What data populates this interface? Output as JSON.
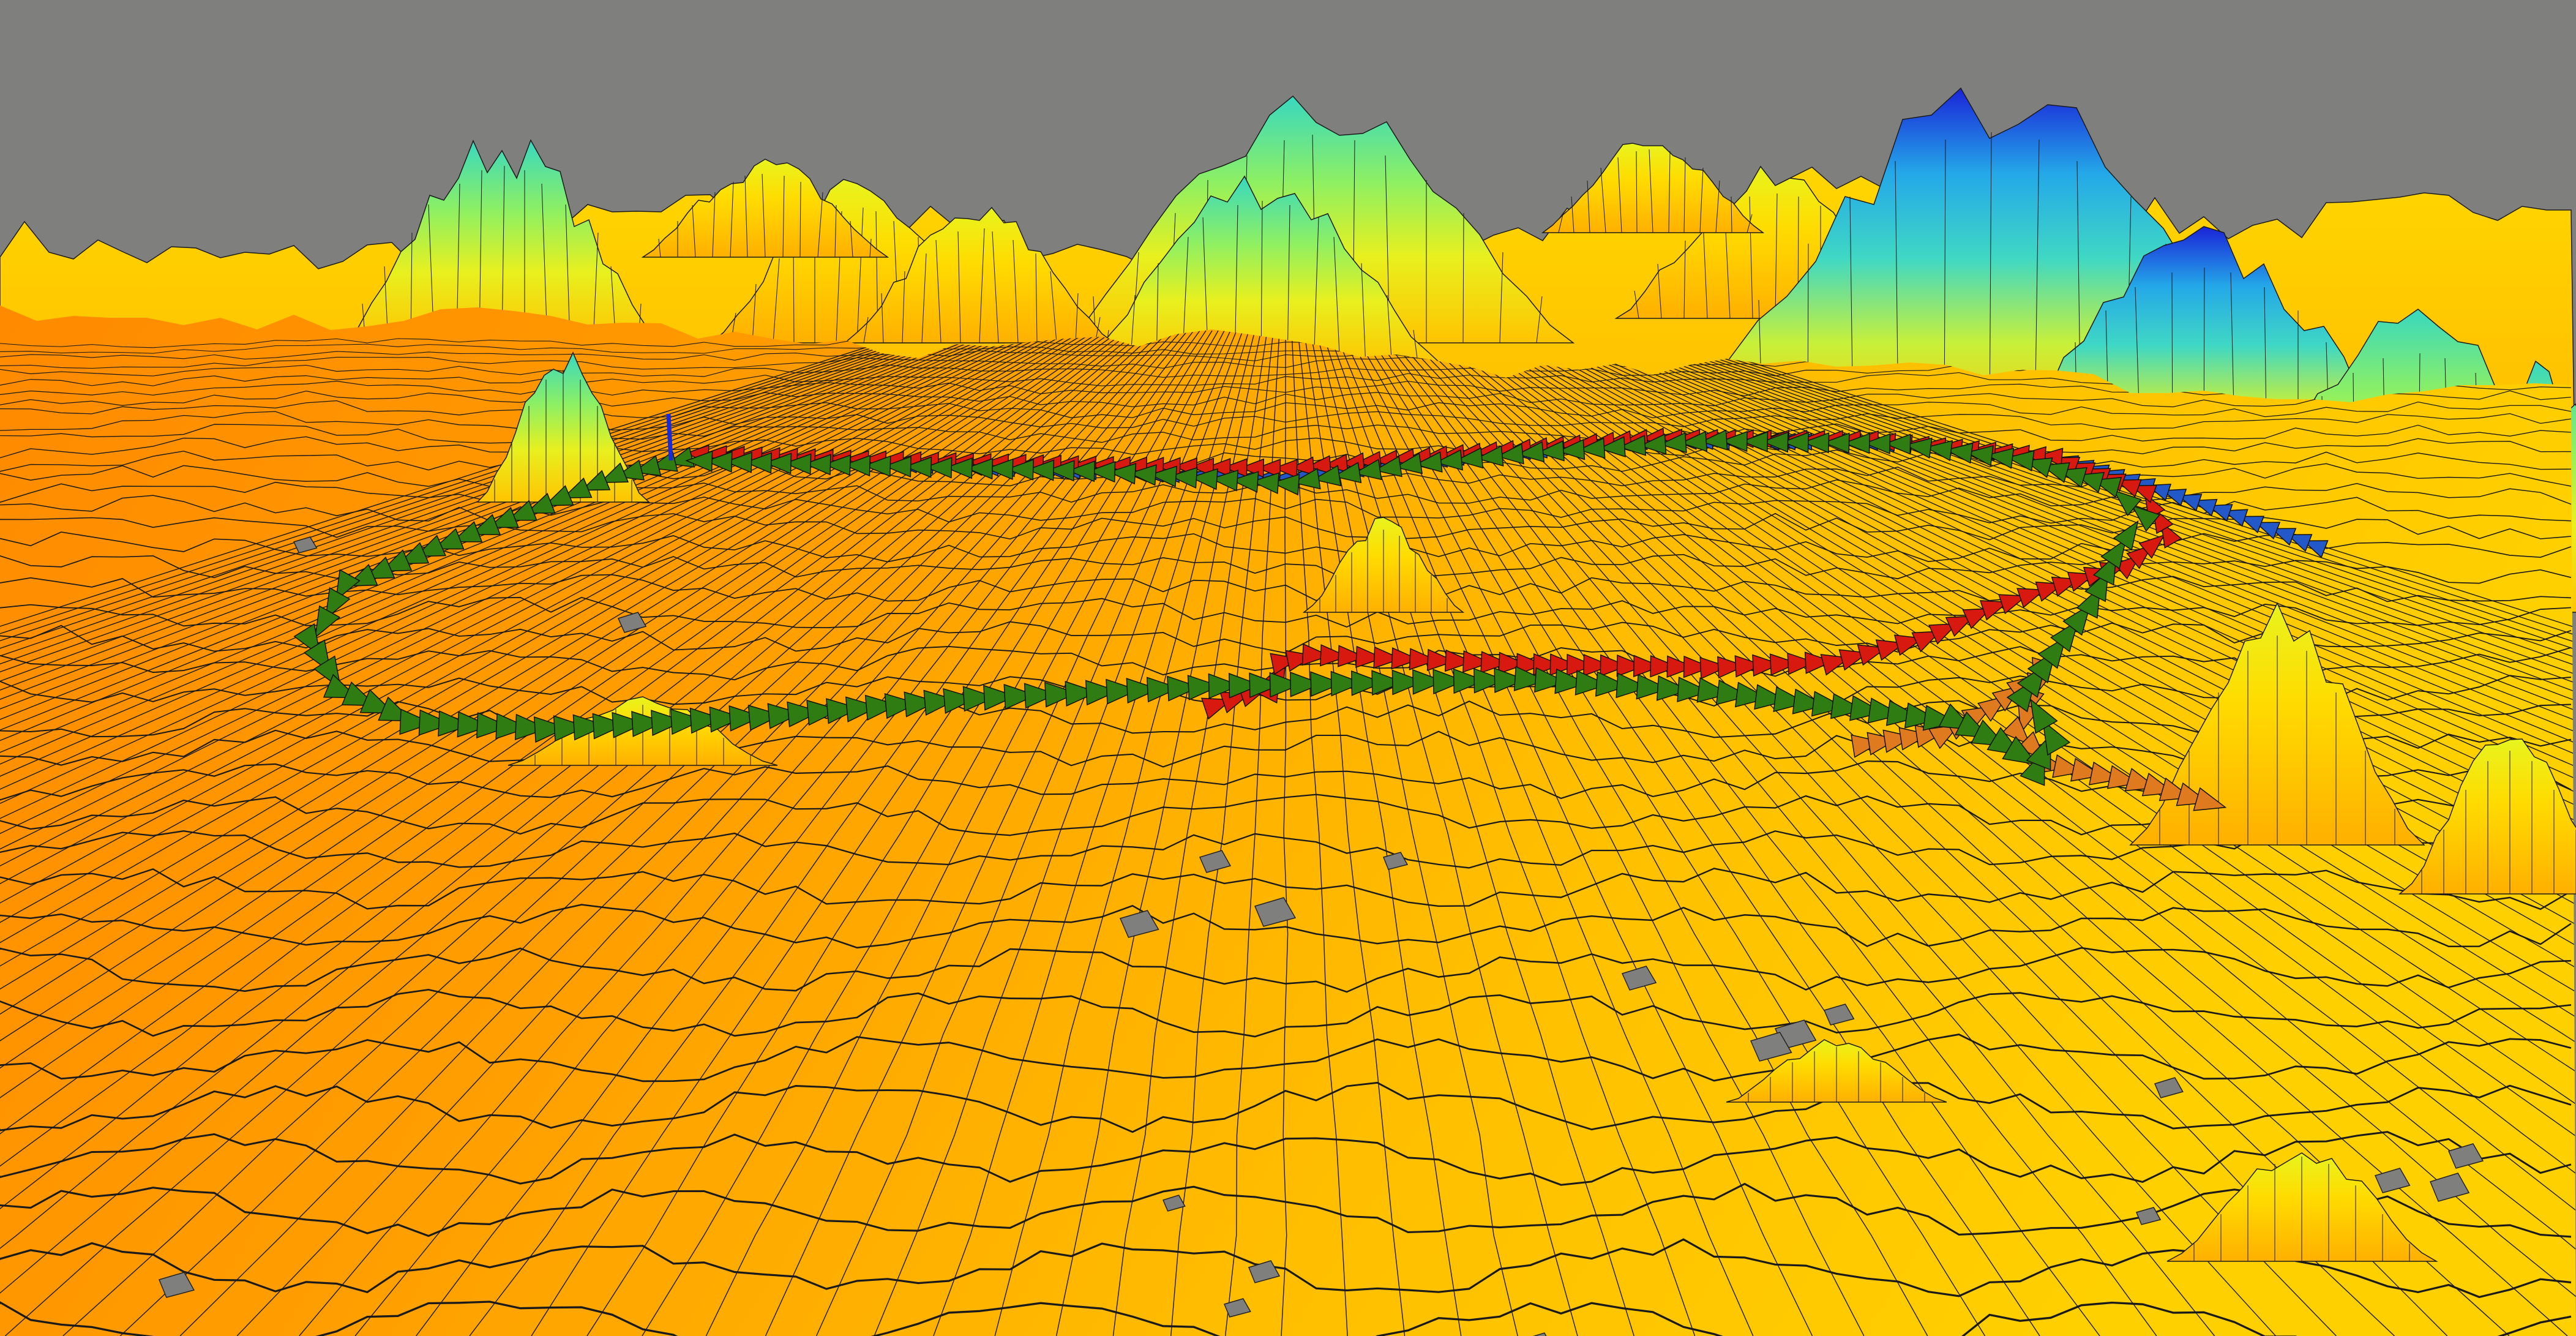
{
  "scene": {
    "background_color": "#7f807e",
    "height_colormap": [
      "#ff8a00",
      "#ffb000",
      "#ffd400",
      "#f2f01e",
      "#9ef05a",
      "#3fe0b8",
      "#24b4e8",
      "#1f5ee8",
      "#1a20d8"
    ],
    "mesh_line_color": "#1a1a1a",
    "trajectories": [
      {
        "color": "#2f7d12",
        "marker": "arrow-chain"
      },
      {
        "color": "#d8190f",
        "marker": "arrow-chain"
      },
      {
        "color": "#2258c8",
        "marker": "arrow-chain"
      },
      {
        "color": "#e07a1e",
        "marker": "arrow-chain"
      }
    ],
    "origin_axis_icon": "axis-marker-icon"
  }
}
